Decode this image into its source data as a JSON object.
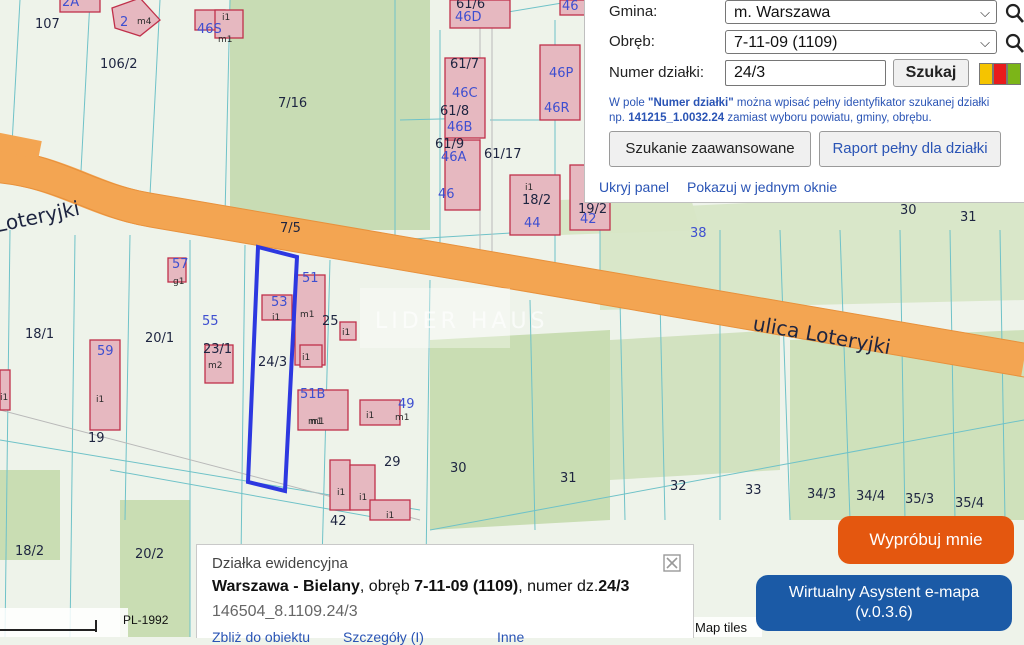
{
  "map": {
    "street_left": "Loteryjki",
    "street_right": "ulica Loteryjki",
    "watermark": "LIDER HAUS",
    "parcels": [
      "107",
      "106/2",
      "7/16",
      "61/6",
      "61/7",
      "61/8",
      "61/9",
      "61/17",
      "7/5",
      "18/1",
      "20/1",
      "23/1",
      "24/3",
      "25",
      "18/2",
      "20/2",
      "42",
      "29",
      "30",
      "31",
      "32",
      "33",
      "34/3",
      "34/4",
      "35/3",
      "35/4",
      "18/2",
      "19/2",
      "30",
      "31",
      "19"
    ],
    "buildings": [
      "2A",
      "2",
      "46S",
      "46D",
      "46",
      "46C",
      "46B",
      "46A",
      "46P",
      "46R",
      "46",
      "44",
      "42",
      "38",
      "57",
      "55",
      "59",
      "51",
      "53",
      "51B",
      "49"
    ],
    "building_types": [
      "m4",
      "m1",
      "i1",
      "g1",
      "m1",
      "m2",
      "i1",
      "i1",
      "m1",
      "i1",
      "m1",
      "i1",
      "m1",
      "i1",
      "i1",
      "i1",
      "i1",
      "i1",
      "i1"
    ],
    "scale": "PL-1992",
    "map_tiles": "Map tiles"
  },
  "panel": {
    "gmina_label": "Gmina:",
    "gmina_value": "m. Warszawa",
    "obreb_label": "Obręb:",
    "obreb_value": "7-11-09 (1109)",
    "numer_label": "Numer działki:",
    "numer_value": "24/3",
    "search_button": "Szukaj",
    "hint_line1_a": "W pole ",
    "hint_line1_b": "\"Numer działki\"",
    "hint_line1_c": " można wpisać pełny identyfikator szukanej działki",
    "hint_line2_a": "np. ",
    "hint_line2_b": "141215_1.0032.24",
    "hint_line2_c": " zamiast wyboru powiatu, gminy, obrębu.",
    "advanced_button": "Szukanie zaawansowane",
    "report_button": "Raport pełny dla działki",
    "hide_link": "Ukryj panel",
    "window_link": "Pokazuj w jednym oknie",
    "colors": [
      "#f5c400",
      "#e81c1c",
      "#7cb518"
    ]
  },
  "info": {
    "title": "Działka ewidencyjna",
    "place": "Warszawa - Bielany",
    "mid1": ", obręb ",
    "obreb": "7-11-09 (1109)",
    "mid2": ", numer dz.",
    "number": "24/3",
    "id": "146504_8.1109.24/3",
    "link1": "Zbliż do obiektu",
    "link2": "Szczegóły (I)",
    "link3": "Inne"
  },
  "assistant": {
    "try_label": "Wypróbuj mnie",
    "title": "Wirtualny Asystent e-mapa",
    "version": "(v.0.3.6)"
  }
}
